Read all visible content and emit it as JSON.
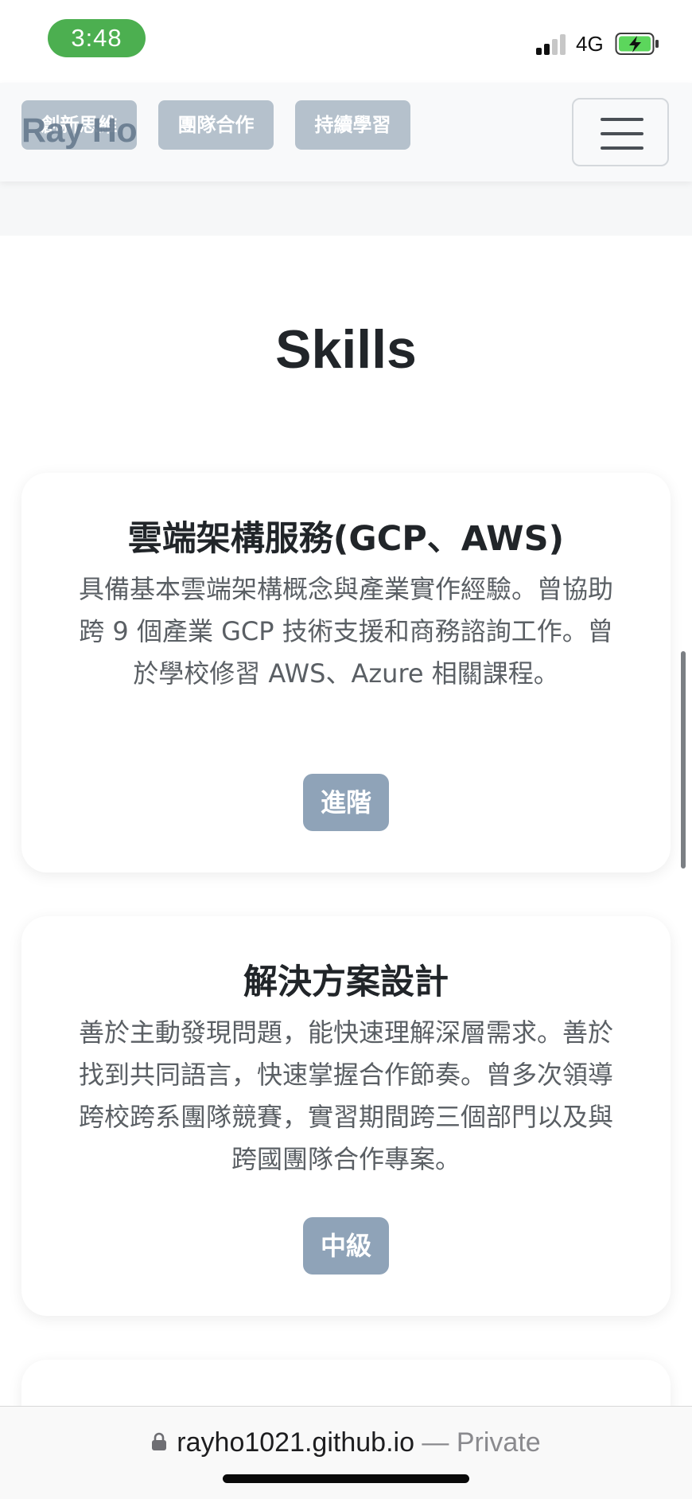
{
  "status_bar": {
    "time": "3:48",
    "network": "4G",
    "icons": [
      "signal-icon",
      "battery-charging-icon"
    ]
  },
  "navbar": {
    "brand": "Ray Ho",
    "chips": [
      "創新思維",
      "團隊合作",
      "持續學習"
    ],
    "menu_icon": "hamburger-menu-icon"
  },
  "section": {
    "title": "Skills"
  },
  "skills": [
    {
      "title": "雲端架構服務(GCP、AWS)",
      "description": "具備基本雲端架構概念與產業實作經驗。曾協助跨 9 個產業 GCP 技術支援和商務諮詢工作。曾於學校修習 AWS、Azure 相關課程。",
      "level": "進階"
    },
    {
      "title": "解決方案設計",
      "description": "善於主動發現問題，能快速理解深層需求。善於找到共同語言，快速掌握合作節奏。曾多次領導跨校跨系團隊競賽，實習期間跨三個部門以及與跨國團隊合作專案。",
      "level": "中級"
    }
  ],
  "browser": {
    "domain": "rayho1021.github.io",
    "suffix": " — Private",
    "lock_icon": "lock-icon"
  },
  "colors": {
    "time_pill": "#4caf50",
    "chip": "#b5c1cc",
    "badge": "#8fa3b8",
    "text_muted": "#5a5f64"
  }
}
